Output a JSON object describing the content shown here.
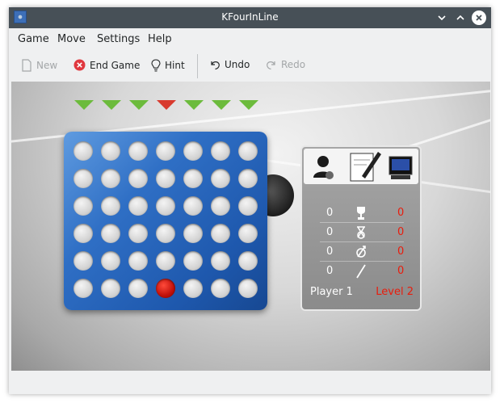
{
  "window": {
    "title": "KFourInLine"
  },
  "menu": [
    "Game",
    "Move",
    "Settings",
    "Help"
  ],
  "toolbar": {
    "new_label": "New",
    "end_game_label": "End Game",
    "hint_label": "Hint",
    "undo_label": "Undo",
    "redo_label": "Redo"
  },
  "game": {
    "columns": 7,
    "rows": 6,
    "highlighted_column": 3,
    "pieces": [
      {
        "row": 5,
        "col": 3,
        "color": "red"
      }
    ],
    "colors": {
      "arrow": "#6cbb3c",
      "arrow_active": "#d83a2e",
      "board": "#2f6fc5",
      "red_piece": "#c0100a"
    }
  },
  "scores": {
    "rows": [
      {
        "icon": "trophy-icon",
        "left": "0",
        "right": "0"
      },
      {
        "icon": "draw-icon",
        "left": "0",
        "right": "0"
      },
      {
        "icon": "loss-icon",
        "left": "0",
        "right": "0"
      },
      {
        "icon": "broken-icon",
        "left": "0",
        "right": "0"
      }
    ],
    "player": "Player 1",
    "level": "Level 2"
  }
}
